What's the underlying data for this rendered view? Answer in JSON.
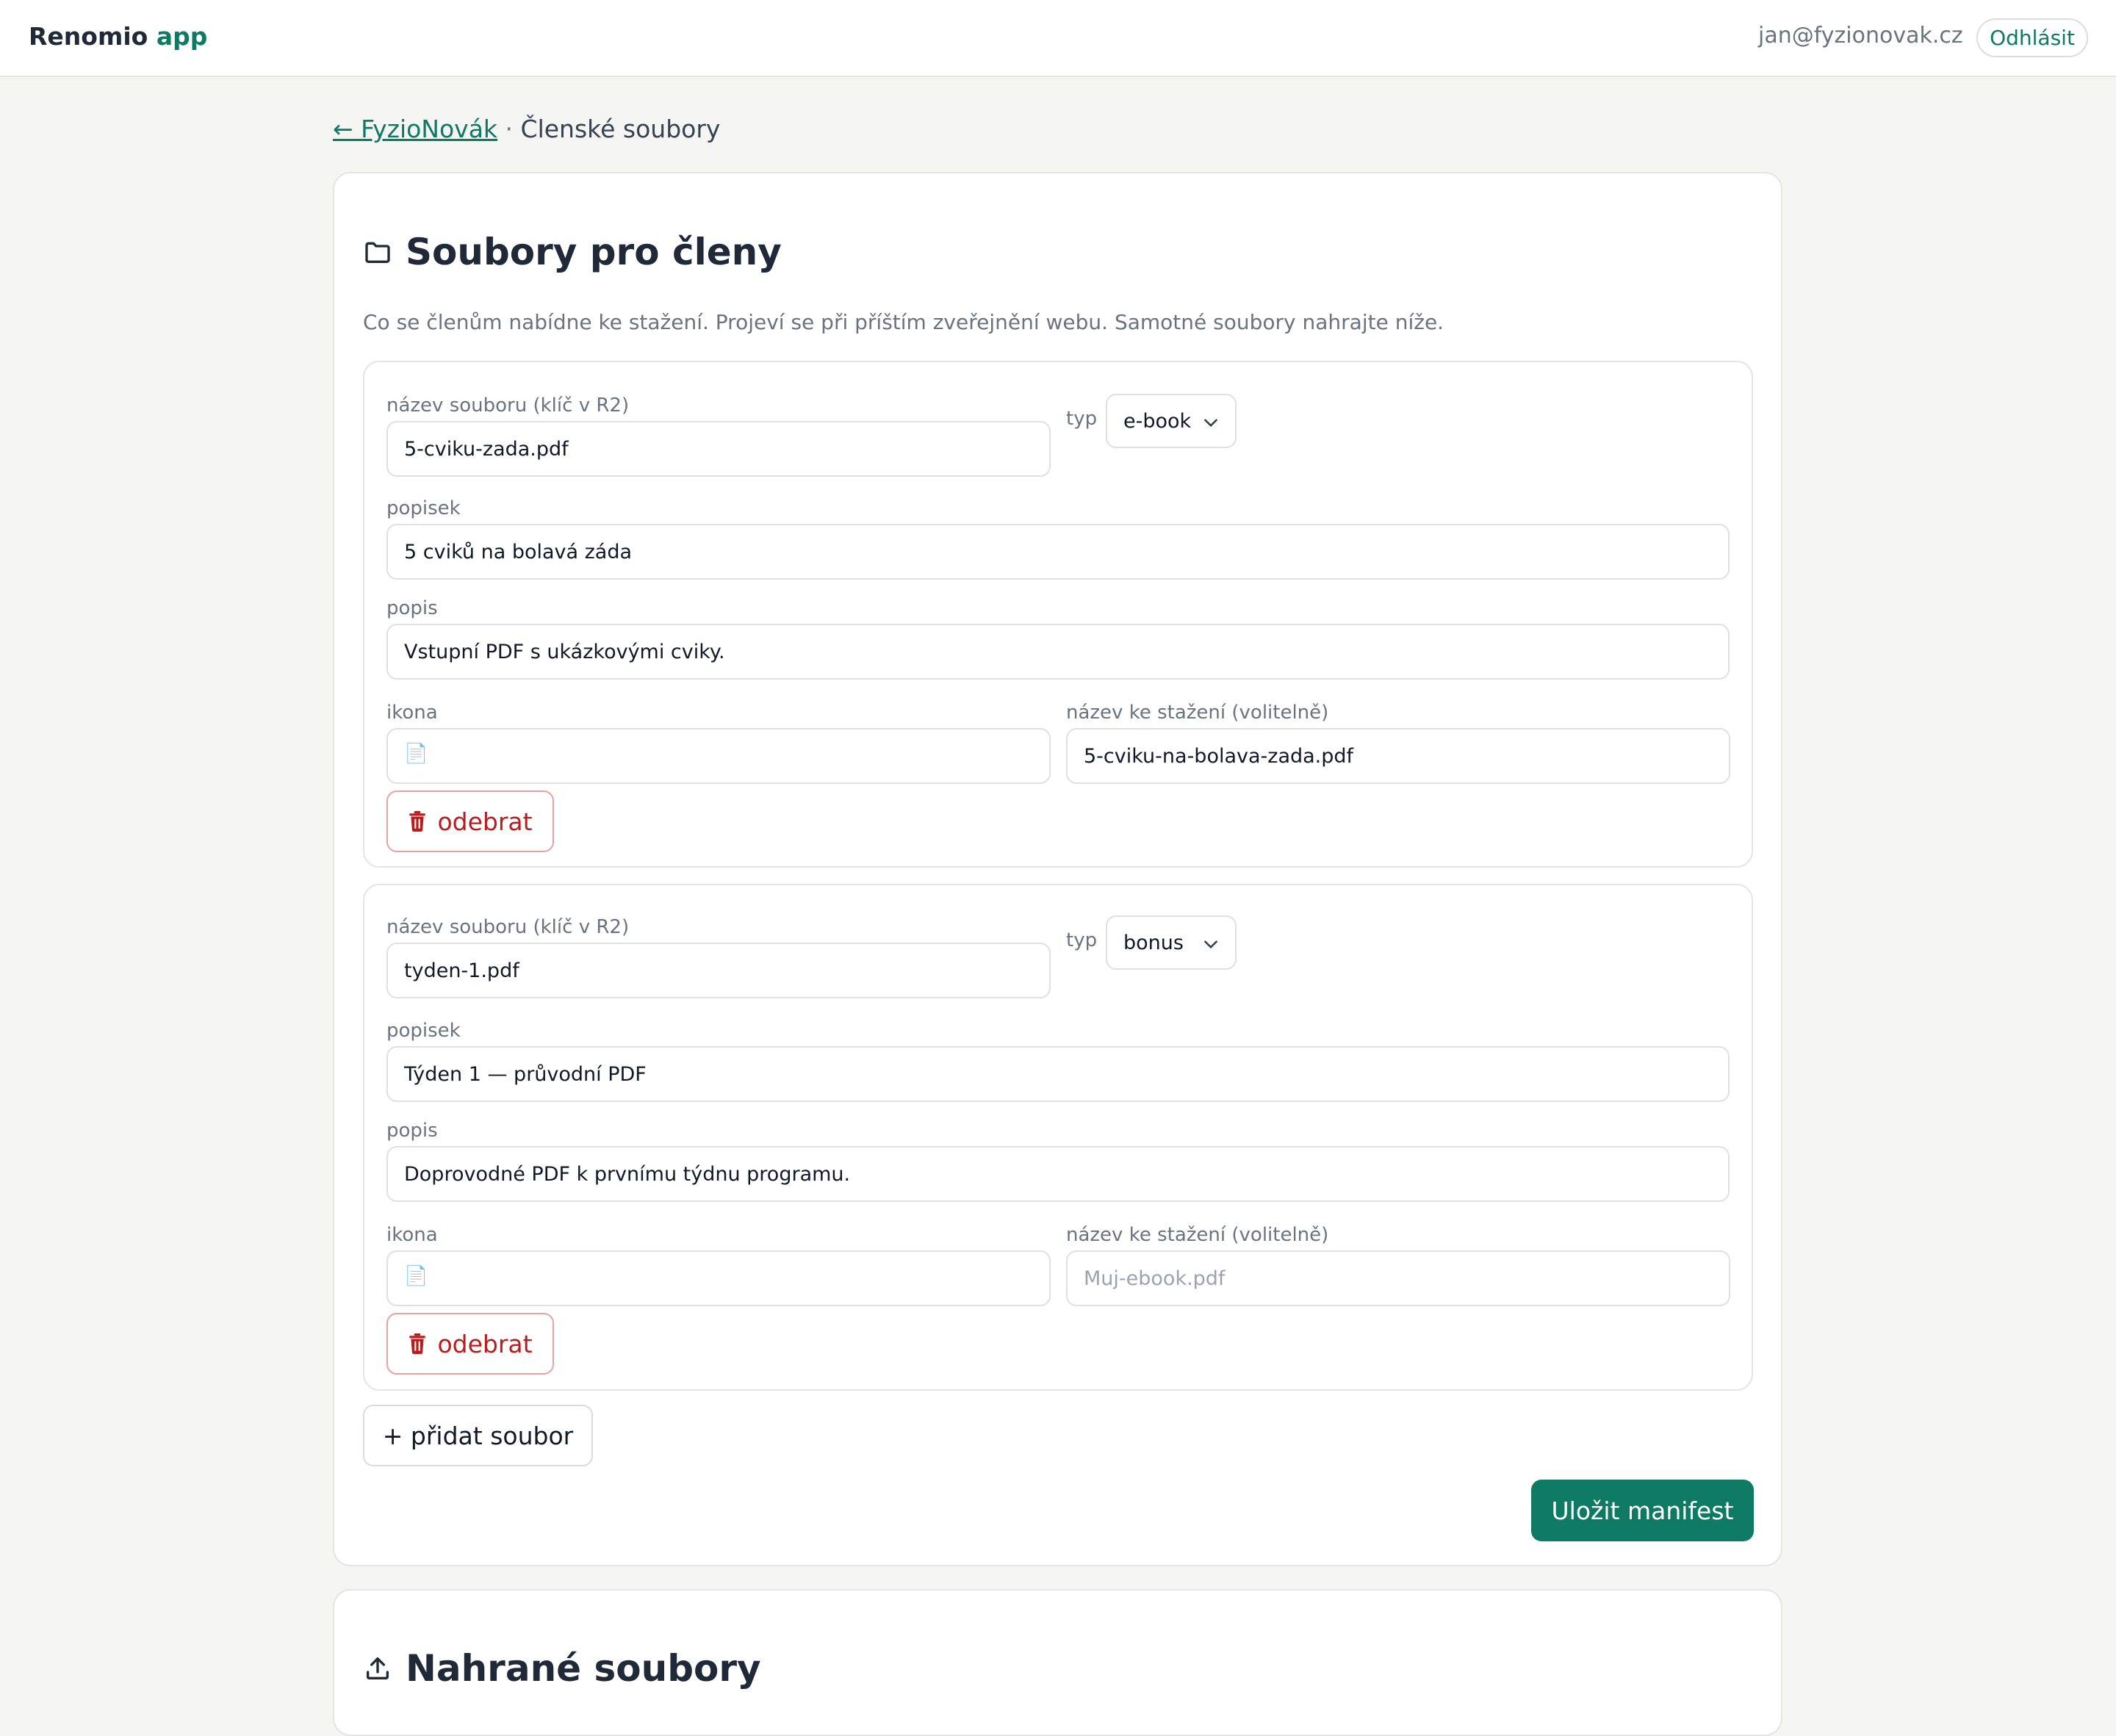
{
  "app": {
    "brand_name": "Renomio",
    "brand_accent": "app",
    "user_email": "jan@fyzionovak.cz",
    "logout_label": "Odhlásit"
  },
  "breadcrumb": {
    "back_link": "← FyzioNovák",
    "separator": "·",
    "current": "Členské soubory"
  },
  "colors": {
    "accent": "#0f7a63",
    "danger": "#b91c1c",
    "background": "#f5f5f4"
  },
  "files_card": {
    "icon": "folder-icon",
    "title": "Soubory pro členy",
    "subtitle": "Co se členům nabídne ke stažení. Projeví se při příštím zveřejnění webu. Samotné soubory nahrajte níže.",
    "labels": {
      "filename": "název souboru (klíč v R2)",
      "type": "typ",
      "label": "popisek",
      "description": "popis",
      "icon": "ikona",
      "download_name": "název ke stažení (volitelně)"
    },
    "files": [
      {
        "filename": "5-cviku-zada.pdf",
        "type": "e-book",
        "label": "5 cviků na bolavá záda",
        "description": "Vstupní PDF s ukázkovými cviky.",
        "icon": "📄",
        "download_name": "5-cviku-na-bolava-zada.pdf",
        "download_placeholder": "Muj-ebook.pdf",
        "remove_label": "odebrat"
      },
      {
        "filename": "tyden-1.pdf",
        "type": "bonus",
        "label": "Týden 1 — průvodní PDF",
        "description": "Doprovodné PDF k prvnímu týdnu programu.",
        "icon": "📄",
        "download_name": "",
        "download_placeholder": "Muj-ebook.pdf",
        "remove_label": "odebrat"
      }
    ],
    "add_label": "+ přidat soubor",
    "save_label": "Uložit manifest"
  },
  "uploads_card": {
    "icon": "upload-icon",
    "title": "Nahrané soubory"
  }
}
